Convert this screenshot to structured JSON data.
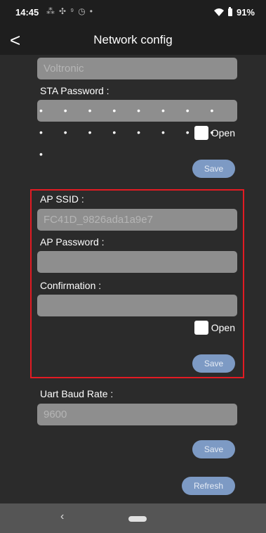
{
  "status_bar": {
    "time": "14:45",
    "notification_icons": [
      "wifi-calling-icon",
      "fan-icon",
      "signal-icon",
      "clock-icon",
      "dot-icon"
    ],
    "battery": "91%"
  },
  "app_bar": {
    "back": "<",
    "title": "Network config"
  },
  "sta": {
    "ssid_value": "Voltronic",
    "password_label": "STA Password :",
    "password_value": "• • • • • • • • • • • • • • • • •",
    "open_label": "Open",
    "save_label": "Save"
  },
  "ap": {
    "ssid_label": "AP SSID :",
    "ssid_placeholder": "FC41D_9826ada1a9e7",
    "password_label": "AP Password :",
    "password_value": "",
    "confirmation_label": "Confirmation :",
    "confirmation_value": "",
    "open_label": "Open",
    "save_label": "Save"
  },
  "uart": {
    "label": "Uart Baud Rate :",
    "placeholder": "9600",
    "save_label": "Save",
    "refresh_label": "Refresh"
  },
  "nav_bar": {
    "back": "‹"
  },
  "colors": {
    "background": "#2b2b2b",
    "field": "#8e8e8e",
    "button": "#7d9ac4",
    "highlight_border": "#e31b23"
  }
}
